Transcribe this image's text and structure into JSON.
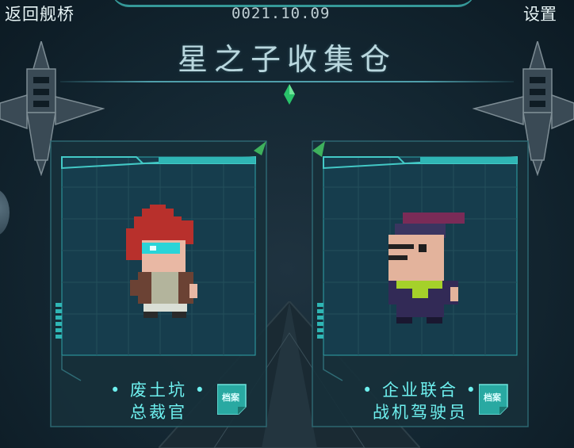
{
  "header": {
    "back_label": "返回舰桥",
    "date": "0021.10.09",
    "settings_label": "设置"
  },
  "page_title": "星之子收集仓",
  "cards": [
    {
      "name_line1": "• 废土坑 •",
      "name_line2": "总裁官",
      "dossier_label": "档案"
    },
    {
      "name_line1": "• 企业联合 •",
      "name_line2": "战机驾驶员",
      "dossier_label": "档案"
    }
  ],
  "colors": {
    "accent": "#3fb7b4",
    "name_text": "#6ef0ef",
    "panel": "#16343f"
  }
}
